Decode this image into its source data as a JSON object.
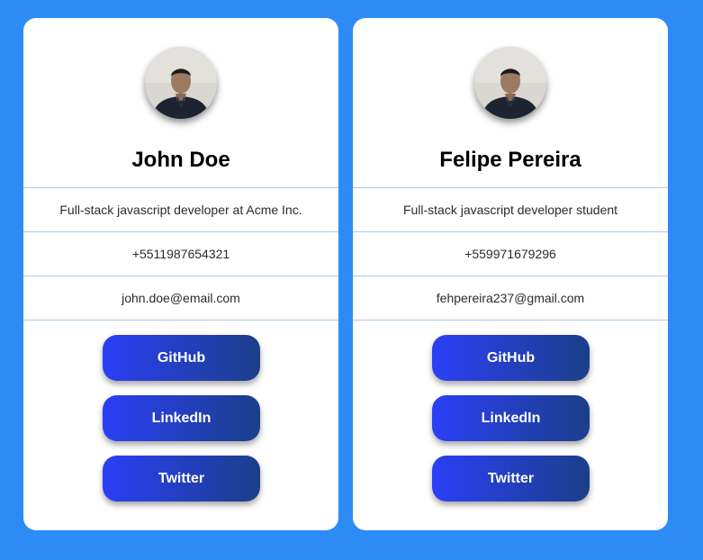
{
  "colors": {
    "page_background": "#2d8bf6",
    "card_background": "#ffffff",
    "divider": "#a9c8e9",
    "button_gradient_start": "#2b3ff6",
    "button_gradient_end": "#1b3f8a"
  },
  "cards": [
    {
      "avatar_icon": "profile-photo",
      "name": "John Doe",
      "title": "Full-stack javascript developer at Acme Inc.",
      "phone": "+5511987654321",
      "email": "john.doe@email.com",
      "buttons": {
        "github": "GitHub",
        "linkedin": "LinkedIn",
        "twitter": "Twitter"
      }
    },
    {
      "avatar_icon": "profile-photo",
      "name": "Felipe Pereira",
      "title": "Full-stack javascript developer student",
      "phone": "+559971679296",
      "email": "fehpereira237@gmail.com",
      "buttons": {
        "github": "GitHub",
        "linkedin": "LinkedIn",
        "twitter": "Twitter"
      }
    }
  ]
}
